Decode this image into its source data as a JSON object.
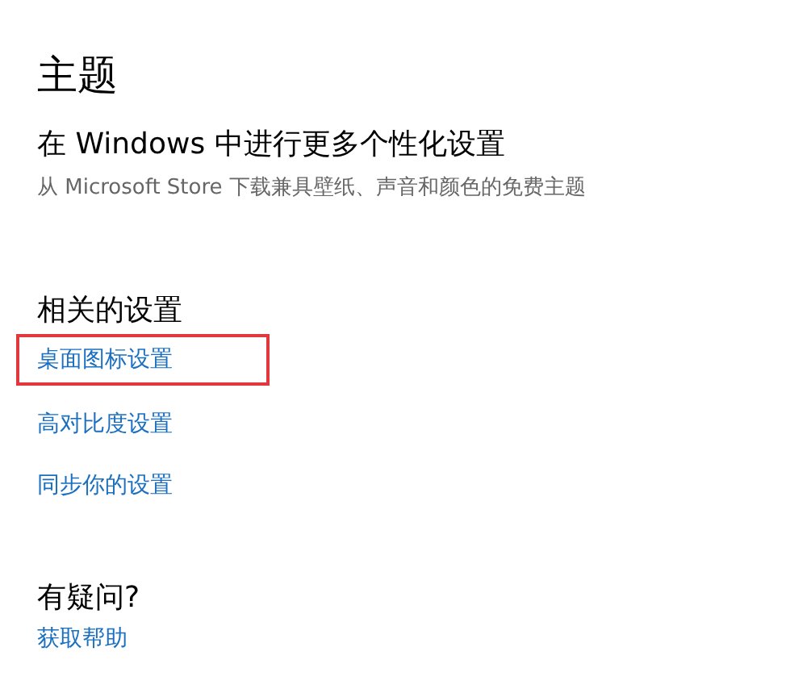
{
  "title": "主题",
  "store_section": {
    "heading": "在 Windows 中进行更多个性化设置",
    "description": "从 Microsoft Store 下载兼具壁纸、声音和颜色的免费主题"
  },
  "related_settings": {
    "heading": "相关的设置",
    "links": [
      {
        "label": "桌面图标设置",
        "highlighted": true
      },
      {
        "label": "高对比度设置",
        "highlighted": false
      },
      {
        "label": "同步你的设置",
        "highlighted": false
      }
    ]
  },
  "help": {
    "heading": "有疑问?",
    "link": "获取帮助"
  }
}
